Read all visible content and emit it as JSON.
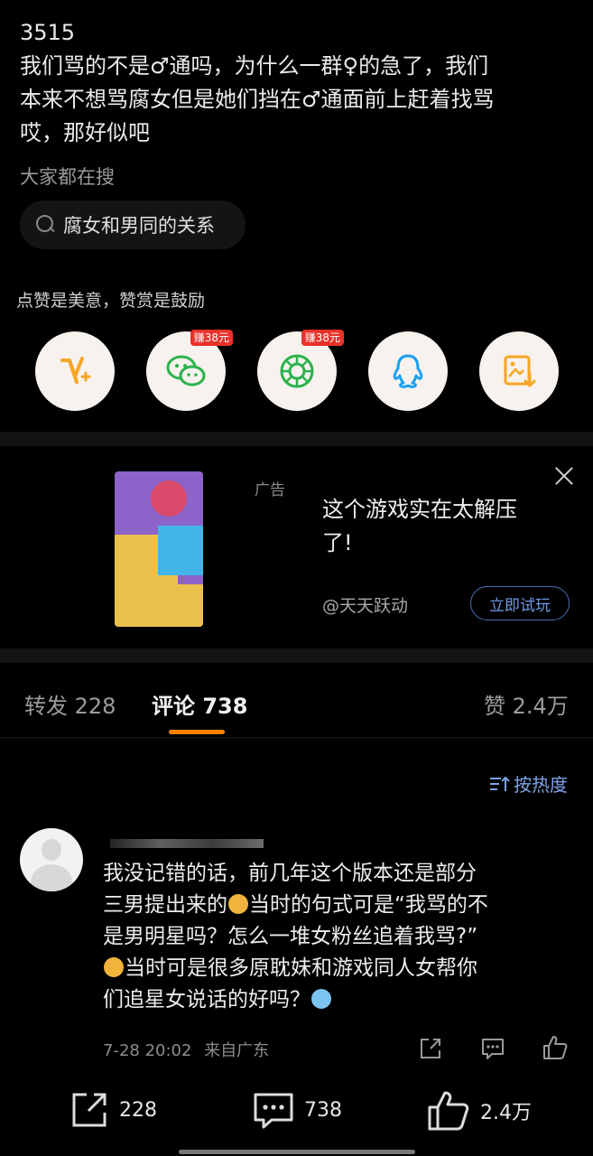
{
  "post": {
    "lines": [
      "3515",
      "我们骂的不是♂通吗，为什么一群♀的急了，我们",
      "本来不想骂腐女但是她们挡在♂通面前上赶着找骂",
      "哎，那好似吧"
    ]
  },
  "search": {
    "title": "大家都在搜",
    "query": "腐女和男同的关系"
  },
  "reward": {
    "hint": "点赞是美意，赞赏是鼓励"
  },
  "share": {
    "items": [
      {
        "name": "reward-button",
        "icon": "reward-v-icon"
      },
      {
        "name": "wechat-share-button",
        "icon": "wechat-icon",
        "badge": "赚38元"
      },
      {
        "name": "moments-share-button",
        "icon": "moments-icon",
        "badge": "赚38元"
      },
      {
        "name": "qq-share-button",
        "icon": "qq-icon"
      },
      {
        "name": "save-image-button",
        "icon": "save-image-icon"
      }
    ]
  },
  "ad": {
    "label": "广告",
    "title_lines": [
      "这个游戏实在太解压",
      "了!"
    ],
    "source": "@天天跃动",
    "cta": "立即试玩"
  },
  "tabs": {
    "repost": "转发 228",
    "comments": "评论 738",
    "likes": "赞 2.4万"
  },
  "sort": {
    "label": "按热度"
  },
  "comment": {
    "lines": [
      "我没记错的话，前几年这个版本还是部分",
      "三男提出来的",
      "当时的句式可是“我骂的不",
      "是男明星吗？怎么一堆女粉丝追着我骂?”",
      "当时可是很多原耽妹和游戏同人女帮你",
      "们追星女说话的好吗？"
    ],
    "time": "7-28 20:02",
    "location": "来自广东"
  },
  "bottom": {
    "repost_count": "228",
    "comment_count": "738",
    "like_count": "2.4万"
  },
  "colors": {
    "accent_orange": "#ff8200",
    "link_blue": "#7ea3e6",
    "badge_red": "#e8322b"
  }
}
